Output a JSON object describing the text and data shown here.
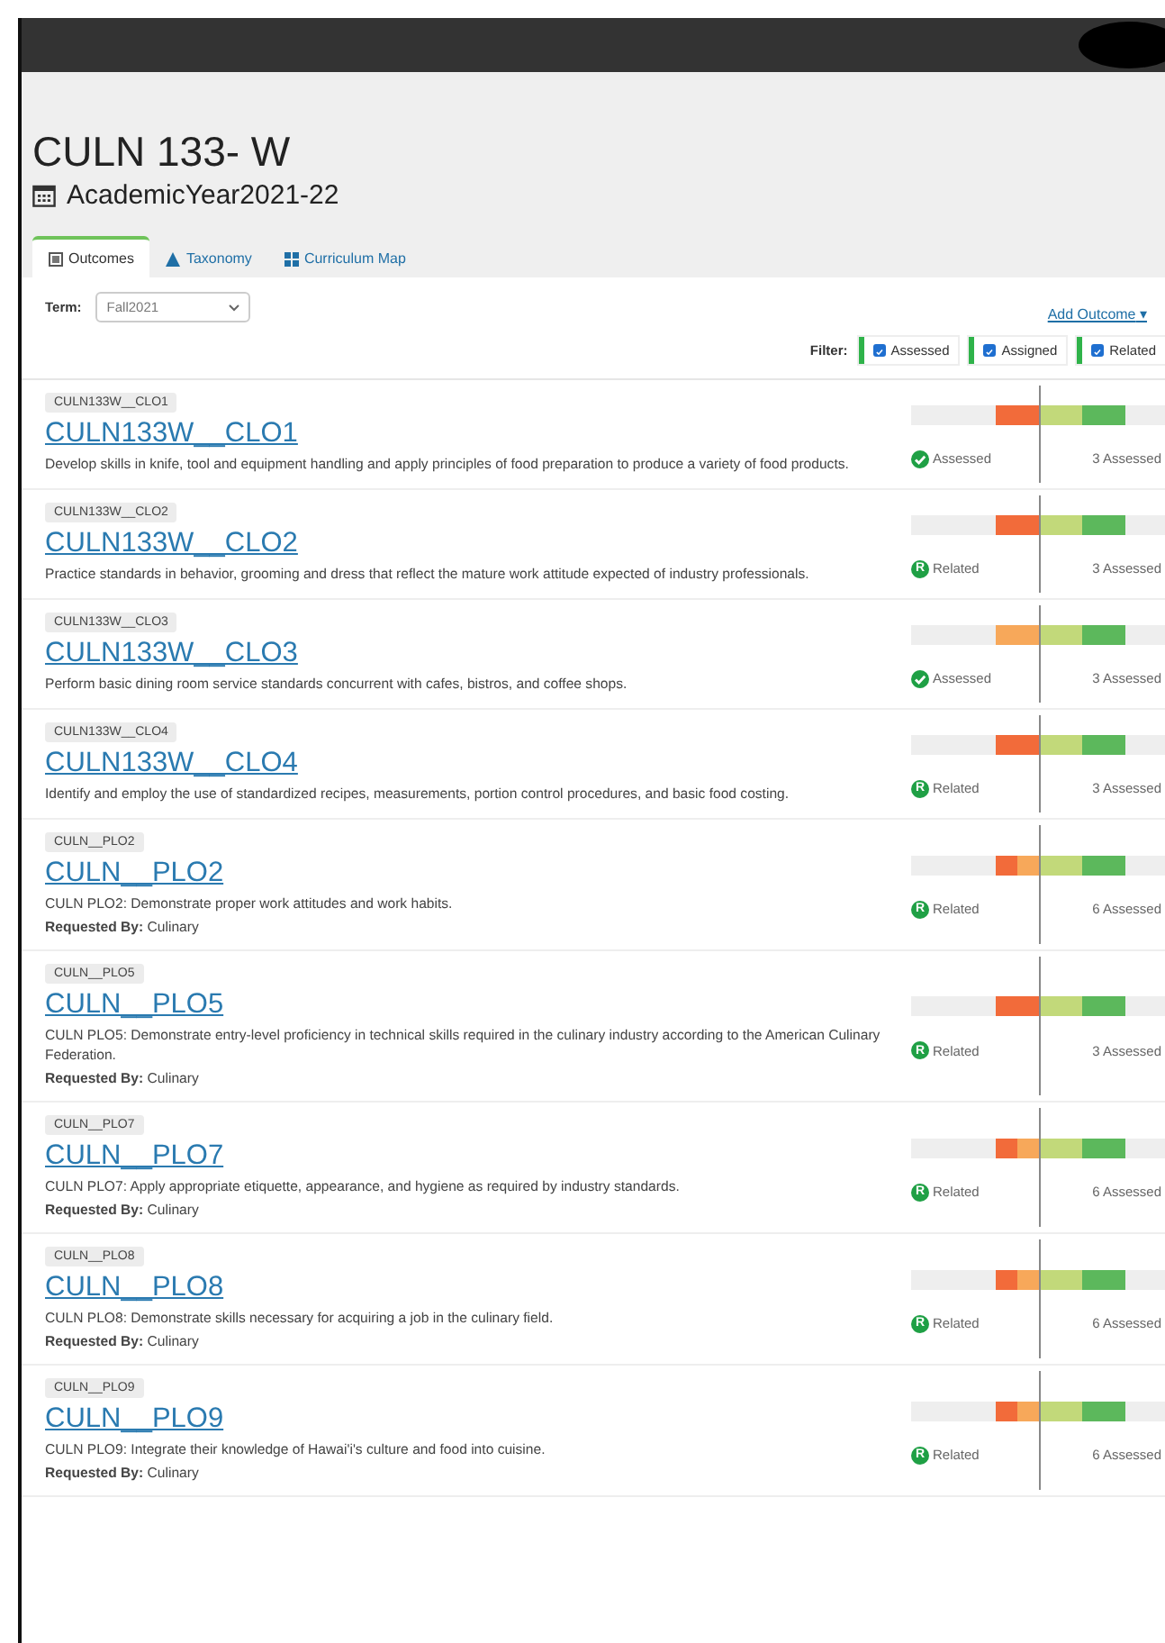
{
  "course": {
    "title": "CULN 133- W",
    "year": "AcademicYear2021-22"
  },
  "tabs": [
    {
      "label": "Outcomes",
      "selected": true
    },
    {
      "label": "Taxonomy",
      "selected": false
    },
    {
      "label": "Curriculum Map",
      "selected": false
    }
  ],
  "term": {
    "label": "Term:",
    "value": "Fall2021"
  },
  "add_outcome": {
    "label": "Add Outcome",
    "caret": "▾"
  },
  "filter": {
    "label": "Filter:",
    "options": [
      {
        "label": "Assessed",
        "checked": true
      },
      {
        "label": "Assigned",
        "checked": true
      },
      {
        "label": "Related",
        "checked": true
      }
    ]
  },
  "outcomes": [
    {
      "code": "CULN133W__CLO1",
      "title": "CULN133W__CLO1",
      "description": "Develop skills in knife, tool and equipment handling and apply principles of food preparation to produce a variety of food products.",
      "status": {
        "kind": "assessed",
        "label": "Assessed"
      },
      "count": "3 Assessed",
      "segments": [
        {
          "kind": "wide",
          "color": "#f26b3a"
        },
        {
          "kind": "wide",
          "color": "#c2d97a"
        },
        {
          "kind": "wide",
          "color": "#5cb85c"
        }
      ]
    },
    {
      "code": "CULN133W__CLO2",
      "title": "CULN133W__CLO2",
      "description": "Practice standards in behavior, grooming and dress that reflect the mature work attitude expected of industry professionals.",
      "status": {
        "kind": "related",
        "label": "Related",
        "letter": "R"
      },
      "count": "3 Assessed",
      "segments": [
        {
          "kind": "wide",
          "color": "#f26b3a"
        },
        {
          "kind": "wide",
          "color": "#c2d97a"
        },
        {
          "kind": "wide",
          "color": "#5cb85c"
        }
      ]
    },
    {
      "code": "CULN133W__CLO3",
      "title": "CULN133W__CLO3",
      "description": "Perform basic dining room service standards concurrent with cafes, bistros, and coffee shops.",
      "status": {
        "kind": "assessed",
        "label": "Assessed"
      },
      "count": "3 Assessed",
      "segments": [
        {
          "kind": "wide",
          "color": "#f7a85a"
        },
        {
          "kind": "wide",
          "color": "#c2d97a"
        },
        {
          "kind": "wide",
          "color": "#5cb85c"
        }
      ]
    },
    {
      "code": "CULN133W__CLO4",
      "title": "CULN133W__CLO4",
      "description": "Identify and employ the use of standardized recipes, measurements, portion control procedures, and basic food costing.",
      "status": {
        "kind": "related",
        "label": "Related",
        "letter": "R"
      },
      "count": "3 Assessed",
      "segments": [
        {
          "kind": "wide",
          "color": "#f26b3a"
        },
        {
          "kind": "wide",
          "color": "#c2d97a"
        },
        {
          "kind": "wide",
          "color": "#5cb85c"
        }
      ]
    },
    {
      "code": "CULN__PLO2",
      "title": "CULN__PLO2",
      "description": "CULN PLO2: Demonstrate proper work attitudes and work habits.",
      "requested_label": "Requested By:",
      "requested_by": "Culinary",
      "status": {
        "kind": "related",
        "label": "Related",
        "letter": "R"
      },
      "count": "6 Assessed",
      "segments": [
        {
          "kind": "narrow",
          "color": "#f26b3a"
        },
        {
          "kind": "narrow",
          "color": "#f7a85a"
        },
        {
          "kind": "wide",
          "color": "#c2d97a"
        },
        {
          "kind": "wide",
          "color": "#5cb85c"
        }
      ]
    },
    {
      "code": "CULN__PLO5",
      "title": "CULN__PLO5",
      "description": "CULN PLO5: Demonstrate entry-level proficiency in technical skills required in the culinary industry according to the American Culinary Federation.",
      "requested_label": "Requested By:",
      "requested_by": "Culinary",
      "status": {
        "kind": "related",
        "label": "Related",
        "letter": "R"
      },
      "count": "3 Assessed",
      "segments": [
        {
          "kind": "wide",
          "color": "#f26b3a"
        },
        {
          "kind": "wide",
          "color": "#c2d97a"
        },
        {
          "kind": "wide",
          "color": "#5cb85c"
        }
      ]
    },
    {
      "code": "CULN__PLO7",
      "title": "CULN__PLO7",
      "description": "CULN PLO7: Apply appropriate etiquette, appearance, and hygiene as required by industry standards.",
      "requested_label": "Requested By:",
      "requested_by": "Culinary",
      "status": {
        "kind": "related",
        "label": "Related",
        "letter": "R"
      },
      "count": "6 Assessed",
      "segments": [
        {
          "kind": "narrow",
          "color": "#f26b3a"
        },
        {
          "kind": "narrow",
          "color": "#f7a85a"
        },
        {
          "kind": "wide",
          "color": "#c2d97a"
        },
        {
          "kind": "wide",
          "color": "#5cb85c"
        }
      ]
    },
    {
      "code": "CULN__PLO8",
      "title": "CULN__PLO8",
      "description": "CULN PLO8: Demonstrate skills necessary for acquiring a job in the culinary field.",
      "requested_label": "Requested By:",
      "requested_by": "Culinary",
      "status": {
        "kind": "related",
        "label": "Related",
        "letter": "R"
      },
      "count": "6 Assessed",
      "segments": [
        {
          "kind": "narrow",
          "color": "#f26b3a"
        },
        {
          "kind": "narrow",
          "color": "#f7a85a"
        },
        {
          "kind": "wide",
          "color": "#c2d97a"
        },
        {
          "kind": "wide",
          "color": "#5cb85c"
        }
      ]
    },
    {
      "code": "CULN__PLO9",
      "title": "CULN__PLO9",
      "description": "CULN PLO9: Integrate their knowledge of Hawai'i's culture and food into cuisine.",
      "requested_label": "Requested By:",
      "requested_by": "Culinary",
      "status": {
        "kind": "related",
        "label": "Related",
        "letter": "R"
      },
      "count": "6 Assessed",
      "segments": [
        {
          "kind": "narrow",
          "color": "#f26b3a"
        },
        {
          "kind": "narrow",
          "color": "#f7a85a"
        },
        {
          "kind": "wide",
          "color": "#c2d97a"
        },
        {
          "kind": "wide",
          "color": "#5cb85c"
        }
      ]
    }
  ]
}
